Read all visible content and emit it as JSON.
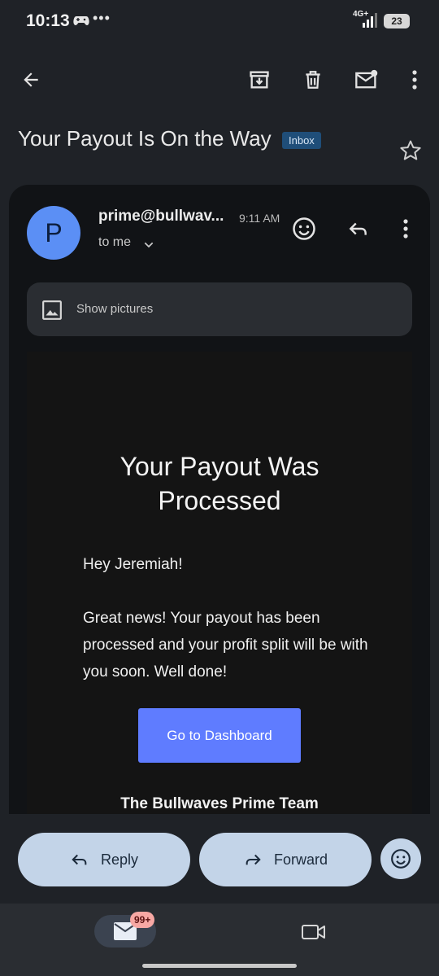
{
  "status_bar": {
    "time": "10:13",
    "network": "4G+",
    "battery": "23"
  },
  "email": {
    "subject": "Your Payout Is On the Way",
    "label": "Inbox",
    "sender": "prime@bullwav...",
    "sender_initial": "P",
    "time": "9:11 AM",
    "recipient": "to me",
    "show_pictures": "Show pictures",
    "body": {
      "title_line1": "Your Payout Was",
      "title_line2": "Processed",
      "greeting": "Hey Jeremiah!",
      "paragraph": "Great news! Your payout has been processed and your profit split will be with you soon. Well done!",
      "cta": "Go to Dashboard",
      "signoff": "The Bullwaves Prime Team"
    }
  },
  "actions": {
    "reply": "Reply",
    "forward": "Forward"
  },
  "nav": {
    "mail_badge": "99+"
  },
  "colors": {
    "accent_button": "#5f7cff",
    "avatar": "#5b8ff5",
    "pill": "#c3d4e8"
  }
}
